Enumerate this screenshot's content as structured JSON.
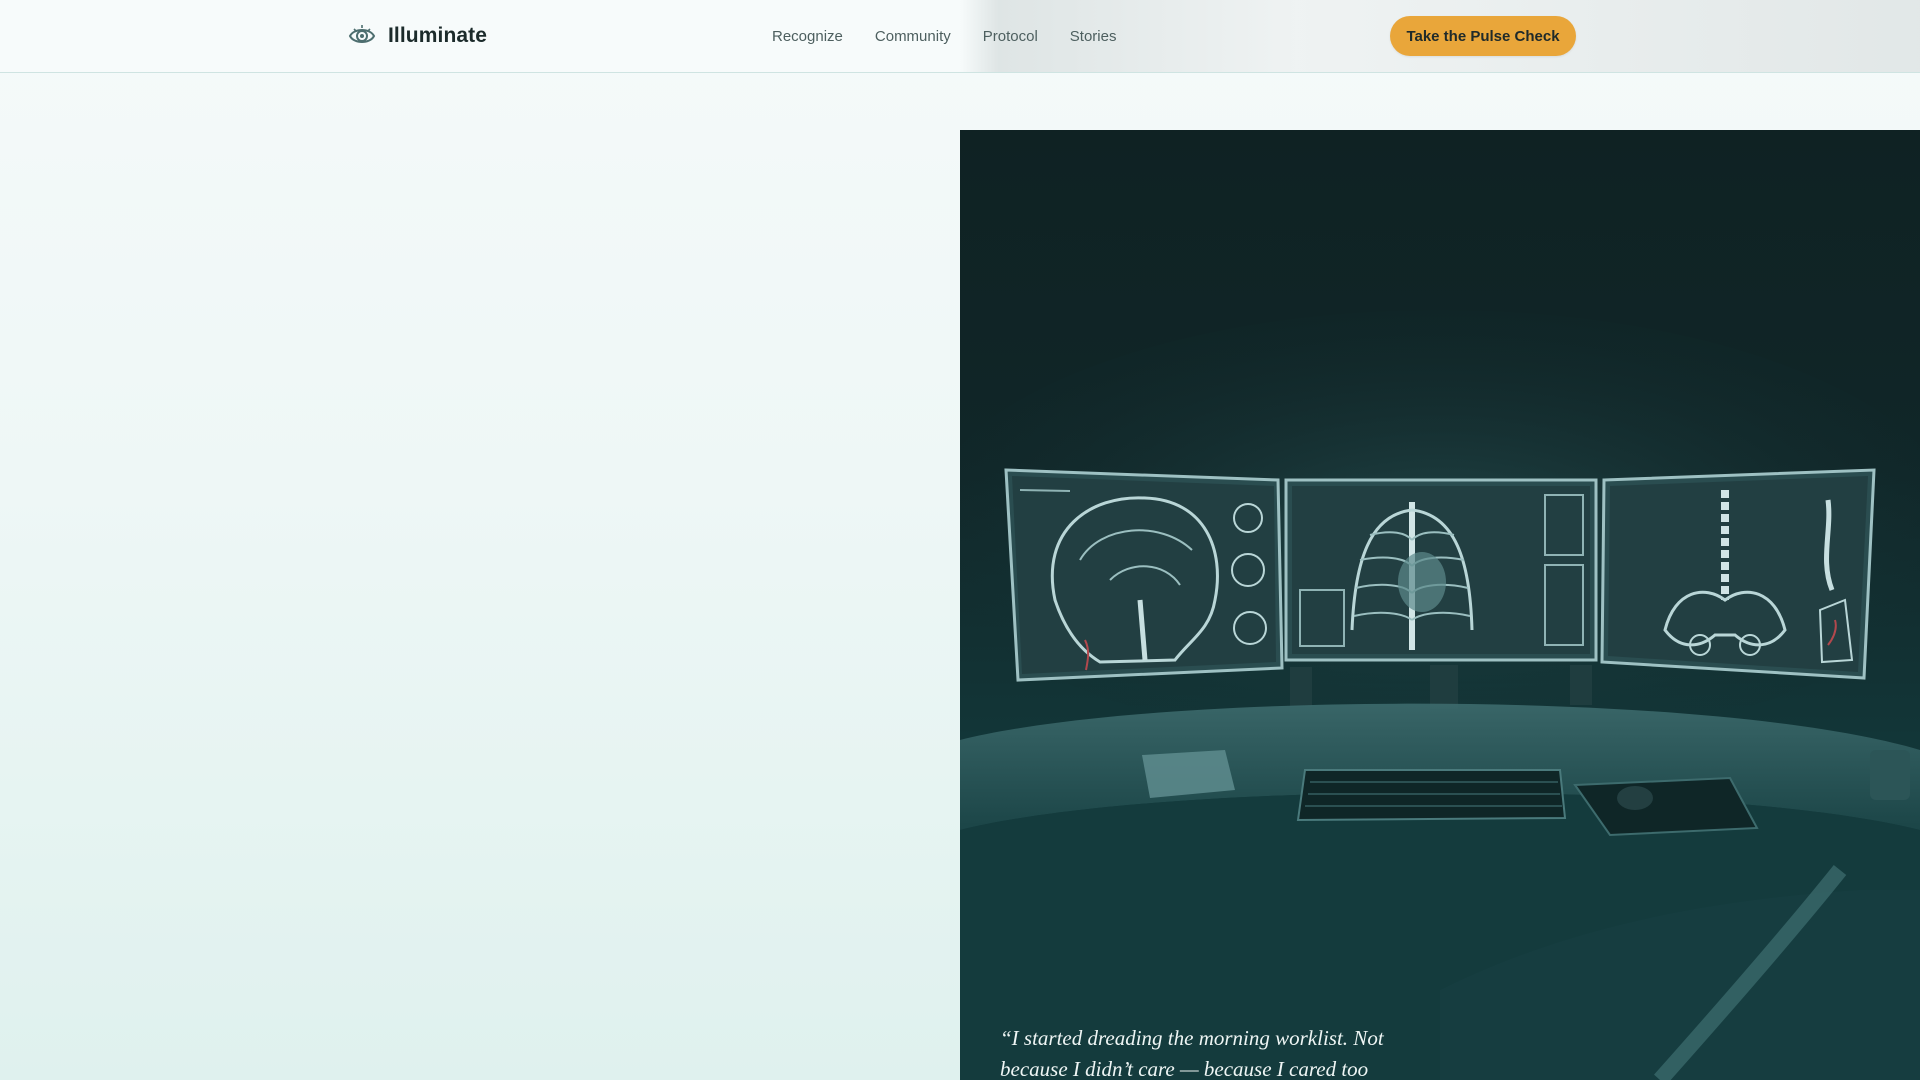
{
  "brand": {
    "name": "Illuminate",
    "icon": "eye-icon"
  },
  "nav": {
    "items": [
      {
        "label": "Recognize"
      },
      {
        "label": "Community"
      },
      {
        "label": "Protocol"
      },
      {
        "label": "Stories"
      }
    ]
  },
  "header": {
    "cta_label": "Take the Pulse Check"
  },
  "hero": {
    "quote": "“I started dreading the morning worklist. Not because I didn’t care — because I cared too"
  },
  "colors": {
    "accent": "#e9a63a",
    "image_panel": "#102628",
    "text": "#1c2b2b"
  }
}
